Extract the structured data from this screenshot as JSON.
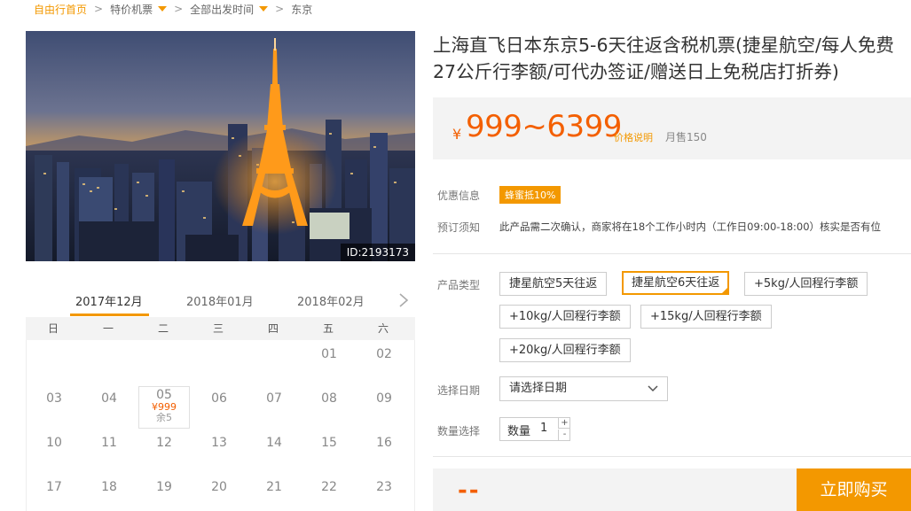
{
  "breadcrumb": [
    {
      "label": "自由行首页",
      "home": true
    },
    {
      "label": "特价机票",
      "dropdown": true
    },
    {
      "label": "全部出发时间",
      "dropdown": true
    },
    {
      "label": "东京"
    }
  ],
  "photo": {
    "id_label": "ID:2193173"
  },
  "calendar": {
    "months": [
      "2017年12月",
      "2018年01月",
      "2018年02月"
    ],
    "active_month_index": 0,
    "weekdays": [
      "日",
      "一",
      "二",
      "三",
      "四",
      "五",
      "六"
    ],
    "weeks": [
      [
        "",
        "",
        "",
        "",
        "",
        "01",
        "02"
      ],
      [
        "03",
        "04",
        "05",
        "06",
        "07",
        "08",
        "09"
      ],
      [
        "10",
        "11",
        "12",
        "13",
        "14",
        "15",
        "16"
      ],
      [
        "17",
        "18",
        "19",
        "20",
        "21",
        "22",
        "23"
      ]
    ],
    "selected_day": {
      "day": "05",
      "price": "¥999",
      "stock": "余5"
    }
  },
  "product": {
    "title": "上海直飞日本东京5-6天往返含税机票(捷星航空/每人免费27公斤行李额/可代办签证/赠送日上免税店打折券)",
    "price_currency": "¥",
    "price_range": "999~6399",
    "price_note": "价格说明",
    "monthly_sales": "月售150"
  },
  "info": {
    "promo_label": "优惠信息",
    "promo_badge": "蜂蜜抵10%",
    "notice_label": "预订须知",
    "notice_text": "此产品需二次确认，商家将在18个工作小时内（工作日09:00-18:00）核实是否有位"
  },
  "options": {
    "type_label": "产品类型",
    "items": [
      {
        "label": "捷星航空5天往返",
        "selected": false
      },
      {
        "label": "捷星航空6天往返",
        "selected": true
      },
      {
        "label": "+5kg/人回程行李额",
        "selected": false
      },
      {
        "label": "+10kg/人回程行李额",
        "selected": false
      },
      {
        "label": "+15kg/人回程行李额",
        "selected": false
      },
      {
        "label": "+20kg/人回程行李额",
        "selected": false
      }
    ],
    "date_label": "选择日期",
    "date_placeholder": "请选择日期",
    "qty_label_left": "数量选择",
    "qty_label": "数量",
    "qty_value": "1",
    "qty_plus": "+",
    "qty_minus": "-"
  },
  "footer": {
    "total": "--",
    "buy_label": "立即购买"
  },
  "colors": {
    "accent": "#f39800",
    "price": "#f35f00"
  }
}
